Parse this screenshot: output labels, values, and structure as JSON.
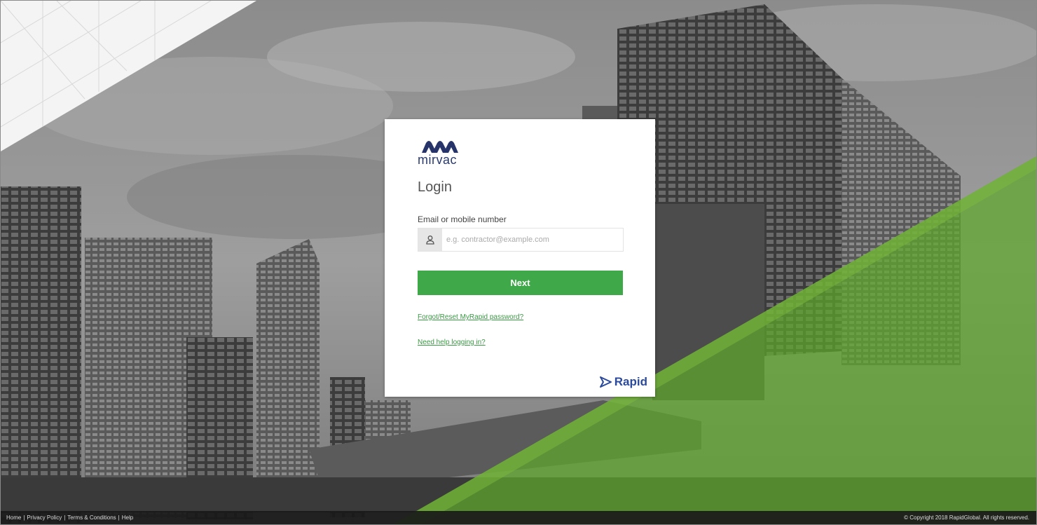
{
  "brand": {
    "logo_text": "mirvac",
    "powered_by": "Rapid"
  },
  "login": {
    "title": "Login",
    "email_label": "Email or mobile number",
    "email_placeholder": "e.g. contractor@example.com",
    "email_value": "",
    "next_label": "Next",
    "forgot_link": "Forgot/Reset MyRapid password?",
    "help_link": "Need help logging in?"
  },
  "footer": {
    "links": [
      "Home",
      "Privacy Policy",
      "Terms & Conditions",
      "Help"
    ],
    "separator": "|",
    "copyright": "© Copyright 2018 RapidGlobal. All rights reserved."
  },
  "colors": {
    "accent_green": "#3fa94a",
    "overlay_green": "#5fa82b",
    "brand_blue": "#2a3b6e"
  },
  "icons": {
    "user": "user-icon",
    "rapid": "rapid-arrow-icon",
    "logo": "mirvac-logo-icon"
  }
}
